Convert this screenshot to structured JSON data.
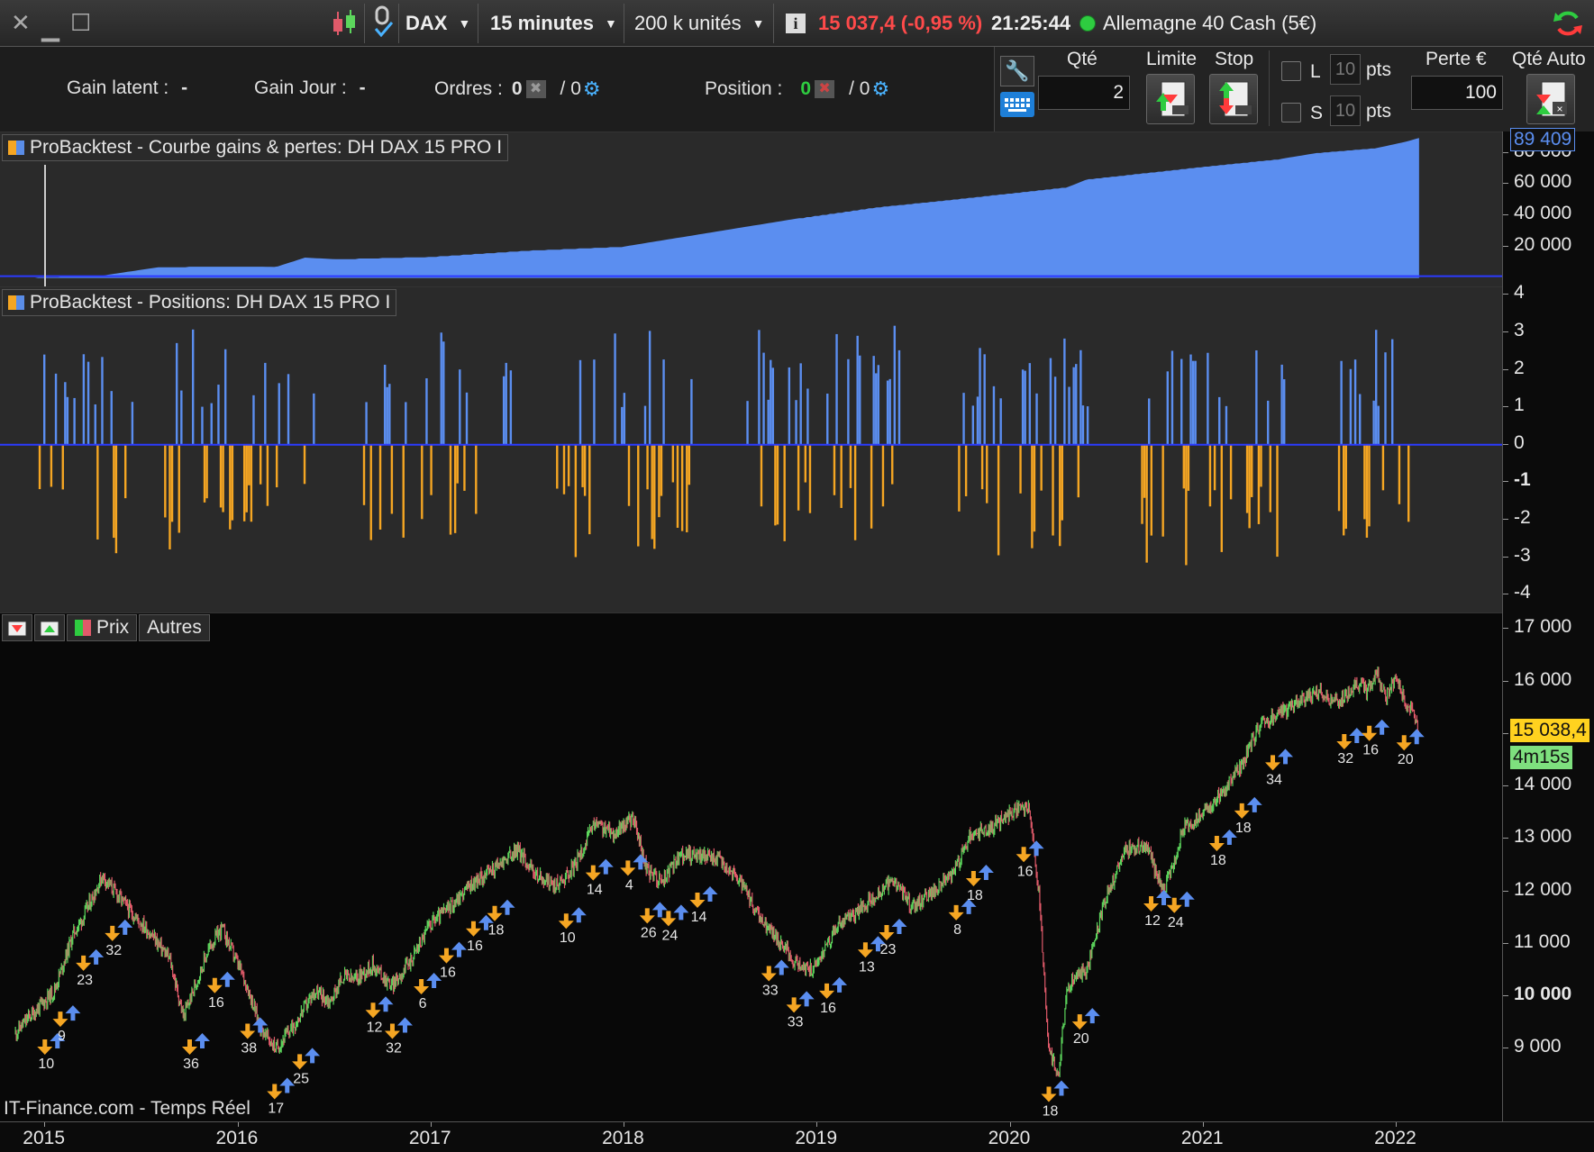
{
  "topbar": {
    "instrument": "DAX",
    "timeframe": "15 minutes",
    "units": "200 k unités",
    "quote": "15 037,4 (-0,95 %)",
    "time": "21:25:44",
    "market": "Allemagne 40 Cash (5€)",
    "colors": {
      "quote": "#ff4a4a",
      "status_dot": "#2ecc40"
    }
  },
  "orderbar": {
    "gain_latent_label": "Gain latent :",
    "gain_latent_value": "-",
    "gain_jour_label": "Gain Jour :",
    "gain_jour_value": "-",
    "ordres_label": "Ordres :",
    "ordres_value": "0",
    "ordres_total": "/ 0",
    "position_label": "Position :",
    "position_value": "0",
    "position_total": "/ 0"
  },
  "order_panel": {
    "qte_label": "Qté",
    "qte_value": "2",
    "limite_label": "Limite",
    "stop_label": "Stop",
    "l_label": "L",
    "s_label": "S",
    "l_pts_value": "10",
    "s_pts_value": "10",
    "pts_label": "pts",
    "perte_label": "Perte €",
    "perte_value": "100",
    "qte_auto_label": "Qté Auto"
  },
  "panels": {
    "equity_title": "ProBacktest - Courbe gains & pertes: DH DAX 15 PRO I",
    "positions_title": "ProBacktest - Positions: DH DAX 15 PRO I",
    "price_tab_label": "Prix",
    "autres_tab_label": "Autres",
    "watermark": "IT-Finance.com - Temps Réel"
  },
  "chart_data": [
    {
      "type": "area",
      "name": "equity",
      "x": [
        2014.85,
        2015.3,
        2015.6,
        2016.0,
        2016.2,
        2016.35,
        2016.5,
        2017.0,
        2017.5,
        2018.0,
        2018.5,
        2018.9,
        2019.3,
        2019.7,
        2020.0,
        2020.3,
        2020.4,
        2020.7,
        2021.0,
        2021.4,
        2021.6,
        2021.9,
        2022.05,
        2022.12
      ],
      "values": [
        0,
        1500,
        7000,
        7500,
        7000,
        13000,
        12000,
        13500,
        17500,
        20000,
        30000,
        38000,
        45000,
        50000,
        54000,
        58000,
        63000,
        67000,
        71000,
        76000,
        80000,
        83000,
        87000,
        89409
      ],
      "last_label": "89 409",
      "ylim": [
        -6000,
        93000
      ],
      "yticks": [
        "20 000",
        "40 000",
        "60 000",
        "80 000"
      ],
      "color": "#5b8ef0"
    },
    {
      "type": "bar",
      "name": "positions",
      "ylim": [
        -4.5,
        4.2
      ],
      "yticks": [
        "4",
        "3",
        "2",
        "1",
        "0",
        "-1",
        "-2",
        "-3",
        "-4"
      ],
      "positive_color": "#5b8ef0",
      "negative_color": "#f5a623"
    },
    {
      "type": "line",
      "name": "price",
      "x": [
        2014.85,
        2014.92,
        2015.0,
        2015.05,
        2015.15,
        2015.2,
        2015.3,
        2015.45,
        2015.55,
        2015.65,
        2015.72,
        2015.85,
        2015.92,
        2016.05,
        2016.12,
        2016.2,
        2016.3,
        2016.4,
        2016.48,
        2016.55,
        2016.6,
        2016.7,
        2016.8,
        2016.9,
        2017.0,
        2017.1,
        2017.2,
        2017.35,
        2017.45,
        2017.55,
        2017.65,
        2017.75,
        2017.85,
        2017.95,
        2018.05,
        2018.12,
        2018.2,
        2018.3,
        2018.4,
        2018.5,
        2018.6,
        2018.7,
        2018.8,
        2018.9,
        2018.98,
        2019.1,
        2019.2,
        2019.3,
        2019.4,
        2019.5,
        2019.6,
        2019.7,
        2019.8,
        2019.9,
        2020.0,
        2020.1,
        2020.15,
        2020.2,
        2020.25,
        2020.3,
        2020.4,
        2020.5,
        2020.6,
        2020.7,
        2020.8,
        2020.9,
        2021.0,
        2021.1,
        2021.2,
        2021.3,
        2021.4,
        2021.5,
        2021.6,
        2021.7,
        2021.8,
        2021.85,
        2021.9,
        2021.95,
        2022.0,
        2022.05,
        2022.1,
        2022.12
      ],
      "values": [
        9300,
        9600,
        9900,
        10100,
        11200,
        11500,
        12300,
        11600,
        11200,
        10700,
        9600,
        10900,
        11300,
        10200,
        9400,
        9000,
        9500,
        10100,
        9900,
        10400,
        10300,
        10600,
        10200,
        10700,
        11400,
        11700,
        12100,
        12500,
        12800,
        12300,
        12100,
        12500,
        13300,
        13100,
        13400,
        12400,
        12200,
        12700,
        12700,
        12600,
        12200,
        11500,
        11100,
        10600,
        10500,
        11300,
        11600,
        11900,
        12200,
        11700,
        12000,
        12300,
        13100,
        13200,
        13500,
        13600,
        12000,
        9000,
        8500,
        10200,
        10500,
        11900,
        12800,
        12900,
        12000,
        13200,
        13500,
        13900,
        14400,
        15200,
        15400,
        15600,
        15800,
        15600,
        16000,
        15800,
        16200,
        15700,
        16100,
        15600,
        15300,
        15038
      ],
      "last_label": "15 038,4",
      "timer_label": "4m15s",
      "yticks": [
        "17 000",
        "16 000",
        "15 000",
        "14 000",
        "13 000",
        "12 000",
        "11 000",
        "10 000",
        "9 000"
      ],
      "ylim": [
        7600,
        17300
      ],
      "up_color": "#5cd65c",
      "down_color": "#e05a6a"
    }
  ],
  "trade_labels": [
    {
      "t": 2015.0,
      "n": "10"
    },
    {
      "t": 2015.08,
      "n": "9"
    },
    {
      "t": 2015.2,
      "n": "23"
    },
    {
      "t": 2015.35,
      "n": "32"
    },
    {
      "t": 2015.75,
      "n": "36"
    },
    {
      "t": 2015.88,
      "n": "16"
    },
    {
      "t": 2016.05,
      "n": "38"
    },
    {
      "t": 2016.19,
      "n": "17"
    },
    {
      "t": 2016.32,
      "n": "25"
    },
    {
      "t": 2016.7,
      "n": "12"
    },
    {
      "t": 2016.8,
      "n": "32"
    },
    {
      "t": 2016.95,
      "n": "6"
    },
    {
      "t": 2017.08,
      "n": "16"
    },
    {
      "t": 2017.22,
      "n": "16"
    },
    {
      "t": 2017.33,
      "n": "18"
    },
    {
      "t": 2017.7,
      "n": "10"
    },
    {
      "t": 2017.84,
      "n": "14"
    },
    {
      "t": 2018.02,
      "n": "4"
    },
    {
      "t": 2018.12,
      "n": "26"
    },
    {
      "t": 2018.23,
      "n": "24"
    },
    {
      "t": 2018.38,
      "n": "14"
    },
    {
      "t": 2018.75,
      "n": "33"
    },
    {
      "t": 2018.88,
      "n": "33"
    },
    {
      "t": 2019.05,
      "n": "16"
    },
    {
      "t": 2019.25,
      "n": "13"
    },
    {
      "t": 2019.36,
      "n": "23"
    },
    {
      "t": 2019.72,
      "n": "8"
    },
    {
      "t": 2019.81,
      "n": "18"
    },
    {
      "t": 2020.07,
      "n": "16"
    },
    {
      "t": 2020.2,
      "n": "18"
    },
    {
      "t": 2020.36,
      "n": "20"
    },
    {
      "t": 2020.73,
      "n": "12"
    },
    {
      "t": 2020.85,
      "n": "24"
    },
    {
      "t": 2021.07,
      "n": "18"
    },
    {
      "t": 2021.2,
      "n": "18"
    },
    {
      "t": 2021.36,
      "n": "34"
    },
    {
      "t": 2021.73,
      "n": "32"
    },
    {
      "t": 2021.86,
      "n": "16"
    },
    {
      "t": 2022.04,
      "n": "20"
    }
  ],
  "xaxis": [
    "2015",
    "2016",
    "2017",
    "2018",
    "2019",
    "2020",
    "2021",
    "2022"
  ]
}
